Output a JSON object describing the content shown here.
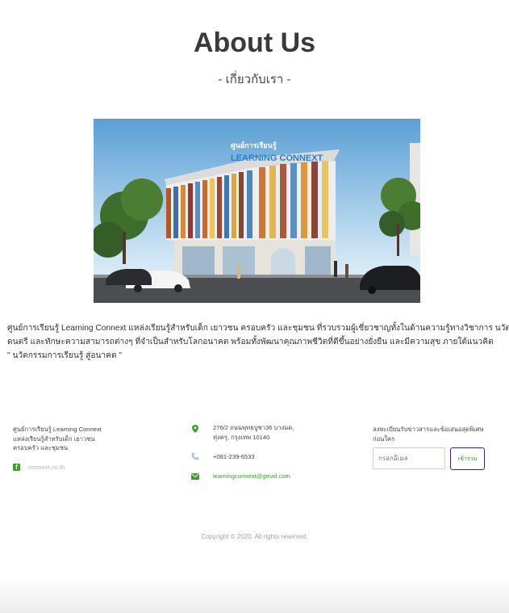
{
  "header": {
    "title": "About Us",
    "subtitle": "- เกี่ยวกับเรา -"
  },
  "hero": {
    "alt": "Learning Connext building",
    "sign_th": "ศูนย์การเรียนรู้",
    "sign_en": "LEARNING CONNEXT"
  },
  "about": {
    "line1": "ศูนย์การเรียนรู้ Learning Connext แหล่งเรียนรู้สำหรับเด็ก เยาวชน ครอบครัว และชุมชน ที่รวบรวมผู้เชี่ยวชาญทั้งในด้านความรู้ทางวิชาการ นวัตกรรม",
    "line2": "ดนตรี และทักษะความสามารถต่างๆ ที่จำเป็นสำหรับโลกอนาคต พร้อมทั้งพัฒนาคุณภาพชีวิตที่ดีขึ้นอย่างยั่งยืน และมีความสุข ภายใต้แนวคิด",
    "line3": "\" นวัตกรรมการเรียนรู้ สู่อนาคต \""
  },
  "footer": {
    "desc_line1": "ศูนย์การเรียนรู้ Learning Connext",
    "desc_line2": "แหล่งเรียนรู้สำหรับเด็ก เยาวชน",
    "desc_line3": "ครอบครัว และชุมชน",
    "facebook_icon": "facebook-icon",
    "website": "connext.co.th",
    "address_line1": "276/2 ถนนพุทธบูชา36 บางมด,",
    "address_line2": "ทุ่งครุ, กรุงเทพ 10140",
    "phone": "+081-239-6533",
    "email": "learningconnext@gmail.com",
    "subscribe_line1": "ลงทะเบียนรับข่าวสารและข้อเสนอสุดพิเศษ",
    "subscribe_line2": "ก่อนใคร",
    "email_placeholder": "กรอกอีเมล",
    "join_label": "เข้าร่วม",
    "accent": "#3e9d2e"
  },
  "copyright": "Copyright © 2020. All rights reserved."
}
